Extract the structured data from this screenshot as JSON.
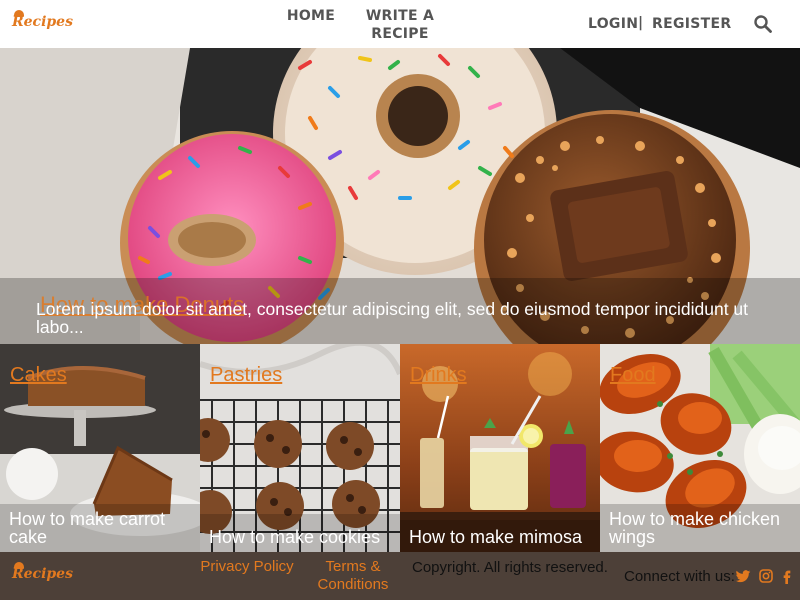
{
  "brand": {
    "logo_text": "Recipes"
  },
  "nav": {
    "home": "HOME",
    "write_recipe": "WRITE A RECIPE",
    "login": "LOGIN",
    "separator": "|",
    "register": "REGISTER"
  },
  "hero": {
    "title": "How to make Donuts",
    "text": "Lorem ipsum dolor sit amet, consectetur adipiscing elit, sed do eiusmod tempor incididunt ut labo..."
  },
  "categories": [
    {
      "name": "Cakes",
      "title": "How to make carrot cake"
    },
    {
      "name": "Pastries",
      "title": "How to make cookies"
    },
    {
      "name": "Drinks",
      "title": "How to make mimosa"
    },
    {
      "name": "Food",
      "title": "How to make chicken wings"
    }
  ],
  "footer": {
    "privacy": "Privacy Policy",
    "terms": "Terms & Conditions",
    "copyright": "Copyright. All rights reserved.",
    "connect": "Connect with us:",
    "social": [
      "twitter-icon",
      "instagram-icon",
      "facebook-icon"
    ]
  },
  "colors": {
    "accent": "#e2791f",
    "footer_bg": "#4d4038",
    "nav_text": "#555555"
  }
}
